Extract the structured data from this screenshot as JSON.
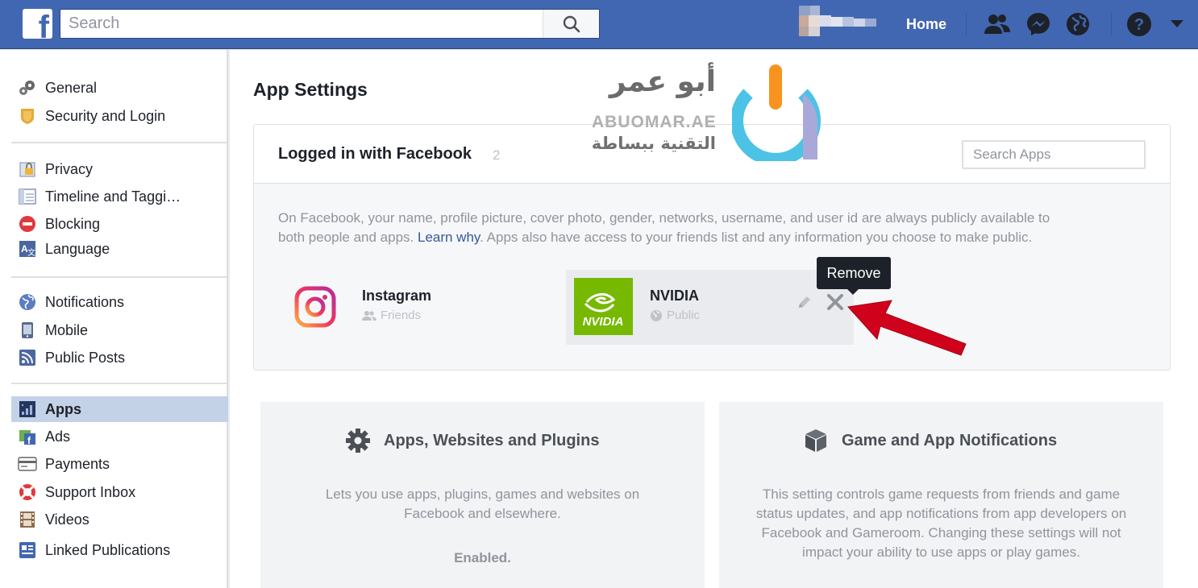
{
  "header": {
    "logo": "f",
    "search_placeholder": "Search",
    "nav_home": "Home"
  },
  "sidebar": {
    "groups": [
      {
        "items": [
          {
            "label": "General",
            "icon": "gears-icon"
          },
          {
            "label": "Security and Login",
            "icon": "shield-badge-icon"
          }
        ]
      },
      {
        "items": [
          {
            "label": "Privacy",
            "icon": "lock-icon"
          },
          {
            "label": "Timeline and Taggi…",
            "icon": "timeline-icon"
          },
          {
            "label": "Blocking",
            "icon": "block-icon"
          },
          {
            "label": "Language",
            "icon": "language-icon"
          }
        ]
      },
      {
        "items": [
          {
            "label": "Notifications",
            "icon": "globe-icon"
          },
          {
            "label": "Mobile",
            "icon": "phone-icon"
          },
          {
            "label": "Public Posts",
            "icon": "rss-icon"
          }
        ]
      },
      {
        "items": [
          {
            "label": "Apps",
            "icon": "apps-icon",
            "active": true
          },
          {
            "label": "Ads",
            "icon": "ads-icon"
          },
          {
            "label": "Payments",
            "icon": "card-icon"
          },
          {
            "label": "Support Inbox",
            "icon": "lifebuoy-icon"
          },
          {
            "label": "Videos",
            "icon": "film-icon"
          },
          {
            "label": "Linked Publications",
            "icon": "publication-icon"
          }
        ]
      }
    ]
  },
  "main": {
    "title": "App Settings",
    "logged_in": {
      "title": "Logged in with Facebook",
      "count": "2",
      "search_placeholder": "Search Apps",
      "info_before": "On Facebook, your name, profile picture, cover photo, gender, networks, username, and user id are always publicly available to both people and apps. ",
      "learn_why": "Learn why",
      "info_after": ". Apps also have access to your friends list and any information you choose to make public.",
      "apps": [
        {
          "name": "Instagram",
          "privacy": "Friends",
          "icon": "instagram-icon"
        },
        {
          "name": "NVIDIA",
          "privacy": "Public",
          "icon": "nvidia-icon",
          "logo_text": "NVIDIA"
        }
      ],
      "tooltip": "Remove"
    },
    "cards": [
      {
        "title": "Apps, Websites and Plugins",
        "icon": "gear-icon",
        "description": "Lets you use apps, plugins, games and websites on Facebook and elsewhere.",
        "status": "Enabled."
      },
      {
        "title": "Game and App Notifications",
        "icon": "cube-icon",
        "description": "This setting controls game requests from friends and game status updates, and app notifications from app developers on Facebook and Gameroom. Changing these settings will not impact your ability to use apps or play games."
      }
    ]
  },
  "watermark": {
    "arabic_name": "أبو عمر",
    "site": "ABUOMAR.AE",
    "tagline": "التقنية ببساطة"
  },
  "colors": {
    "fb_blue": "#4267b2",
    "active_item": "#c4d2e7",
    "link": "#365899",
    "arrow_red": "#d0021b"
  }
}
